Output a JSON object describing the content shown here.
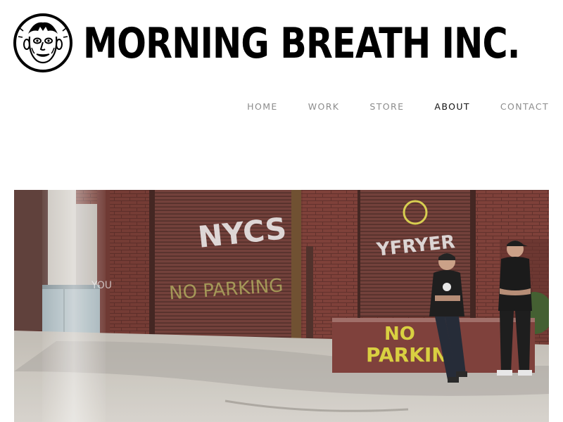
{
  "site": {
    "logo_text": "MORNING BREATH INC.",
    "logo_icon": "cartoon-face-logo-icon"
  },
  "nav": {
    "items": [
      {
        "label": "HOME",
        "active": false
      },
      {
        "label": "WORK",
        "active": false
      },
      {
        "label": "STORE",
        "active": false
      },
      {
        "label": "ABOUT",
        "active": true
      },
      {
        "label": "CONTACT",
        "active": false
      }
    ]
  },
  "hero": {
    "sign_line1": "NO",
    "sign_line2": "PARKIN",
    "graffiti_door_main": "NYCS",
    "graffiti_door_sub": "NO PARKING",
    "graffiti_right": "YFRYER",
    "graffiti_left": "YOU"
  },
  "colors": {
    "active_nav": "#111111",
    "inactive_nav": "#8c8c8c",
    "brick": "#7a3a32",
    "shutter": "#6e3a34",
    "sign_yellow": "#d8cf3a"
  }
}
